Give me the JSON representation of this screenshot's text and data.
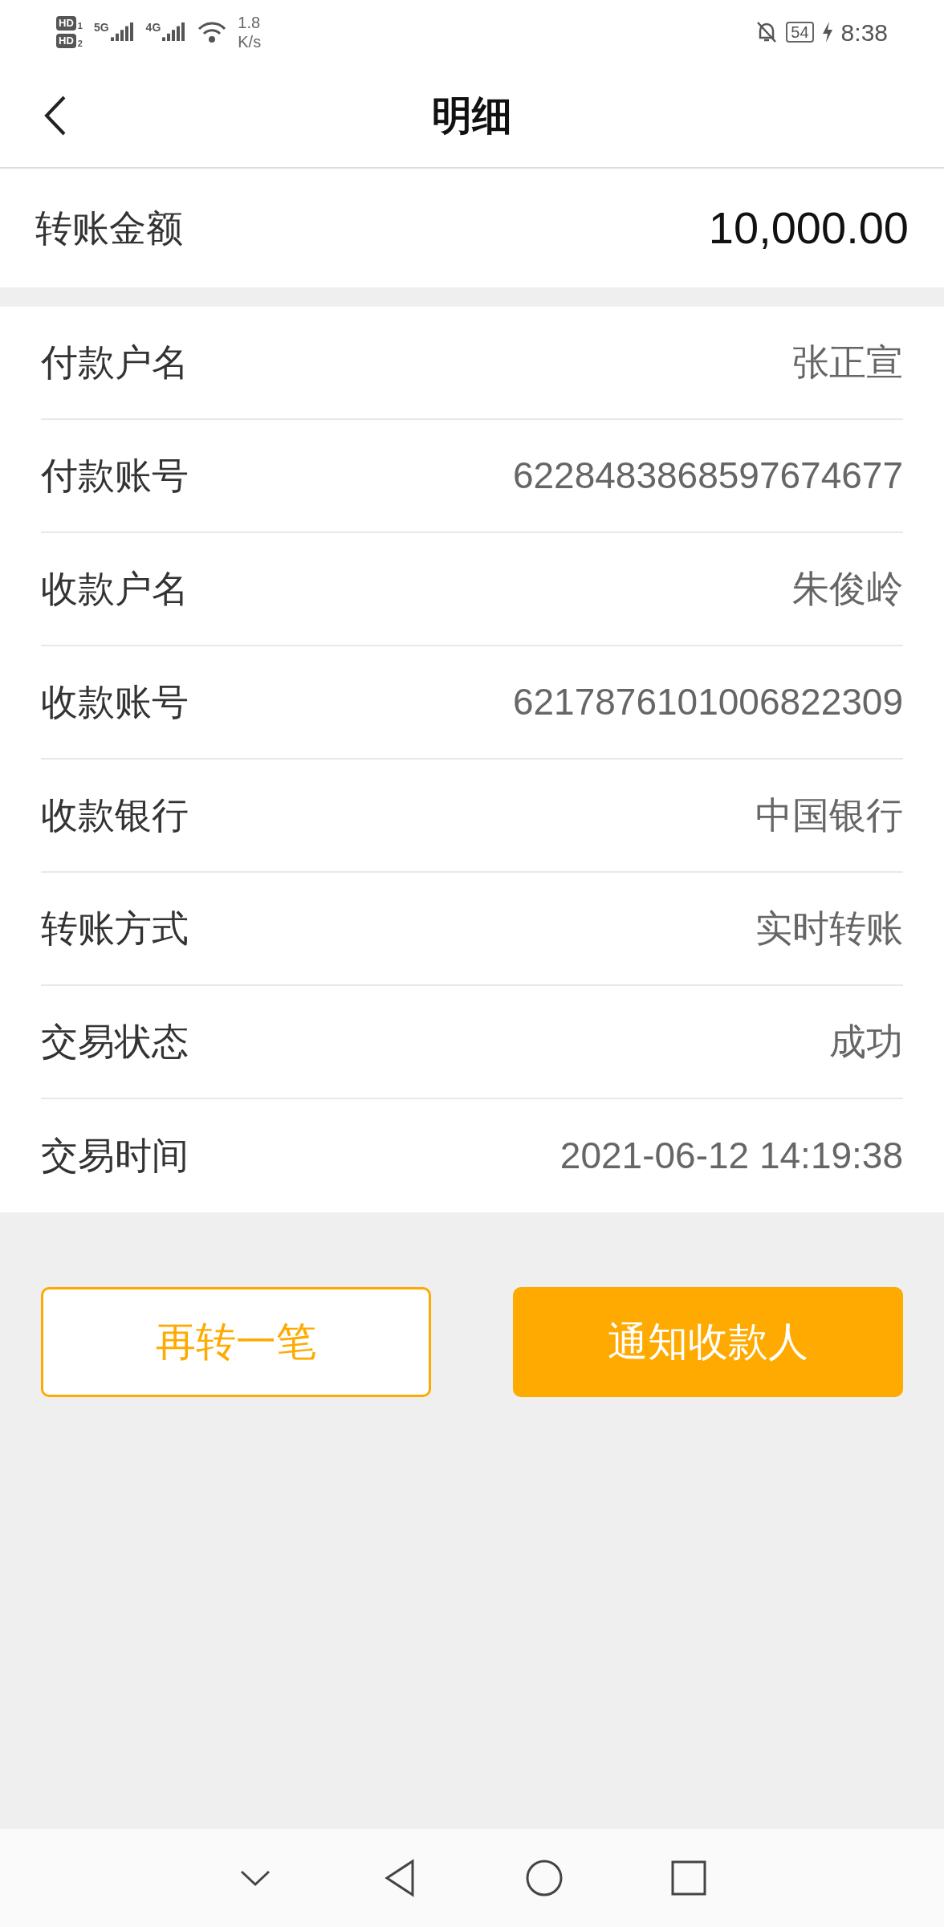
{
  "status_bar": {
    "sims": [
      {
        "badge": "HD",
        "slot": "1"
      },
      {
        "badge": "HD",
        "slot": "2"
      }
    ],
    "signals": [
      {
        "network": "5G"
      },
      {
        "network": "4G"
      }
    ],
    "speed": "1.8",
    "speed_unit": "K/s",
    "battery": "54",
    "time": "8:38"
  },
  "header": {
    "title": "明细"
  },
  "amount": {
    "label": "转账金额",
    "value": "10,000.00"
  },
  "details": [
    {
      "label": "付款户名",
      "value": "张正宣"
    },
    {
      "label": "付款账号",
      "value": "6228483868597674677"
    },
    {
      "label": "收款户名",
      "value": "朱俊岭"
    },
    {
      "label": "收款账号",
      "value": "6217876101006822309"
    },
    {
      "label": "收款银行",
      "value": "中国银行"
    },
    {
      "label": "转账方式",
      "value": "实时转账"
    },
    {
      "label": "交易状态",
      "value": "成功"
    },
    {
      "label": "交易时间",
      "value": "2021-06-12 14:19:38"
    }
  ],
  "buttons": [
    {
      "label": "再转一笔",
      "kind": "outline"
    },
    {
      "label": "通知收款人",
      "kind": "filled"
    }
  ]
}
